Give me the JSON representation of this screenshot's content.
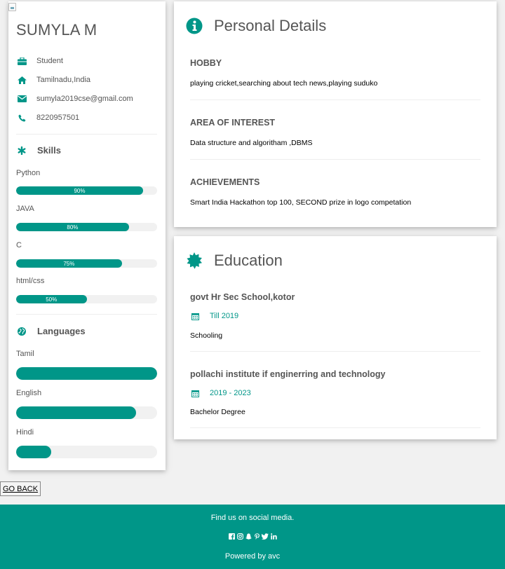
{
  "profile": {
    "name": "SUMYLA M",
    "info": [
      {
        "icon": "briefcase-icon",
        "text": "Student"
      },
      {
        "icon": "home-icon",
        "text": "Tamilnadu,India"
      },
      {
        "icon": "envelope-icon",
        "text": "sumyla2019cse@gmail.com"
      },
      {
        "icon": "phone-icon",
        "text": "8220957501"
      }
    ]
  },
  "skills": {
    "title": "Skills",
    "items": [
      {
        "label": "Python",
        "percent_text": "90%",
        "level": 0.9
      },
      {
        "label": "JAVA",
        "percent_text": "80%",
        "level": 0.8
      },
      {
        "label": "C",
        "percent_text": "75%",
        "level": 0.75
      },
      {
        "label": "html/css",
        "percent_text": "50%",
        "level": 0.5
      }
    ]
  },
  "languages": {
    "title": "Languages",
    "items": [
      {
        "label": "Tamil",
        "level": 1.0
      },
      {
        "label": "English",
        "level": 0.85
      },
      {
        "label": "Hindi",
        "level": 0.25
      }
    ]
  },
  "personal": {
    "title": "Personal Details",
    "sections": [
      {
        "heading": "HOBBY",
        "text": "playing cricket,searching about tech news,playing suduko"
      },
      {
        "heading": "AREA OF INTEREST",
        "text": "Data structure and algoritham ,DBMS"
      },
      {
        "heading": "ACHIEVEMENTS",
        "text": "Smart India Hackathon top 100, SECOND prize in logo competation"
      }
    ]
  },
  "education": {
    "title": "Education",
    "items": [
      {
        "school": "govt Hr Sec School,kotor",
        "date": "Till 2019",
        "degree": "Schooling"
      },
      {
        "school": "pollachi institute if enginerring and technology",
        "date": "2019 - 2023",
        "degree": "Bachelor Degree"
      }
    ]
  },
  "go_back_label": "GO BACK",
  "footer": {
    "find_us": "Find us on social media.",
    "social_icons": [
      "facebook-icon",
      "instagram-icon",
      "snapchat-icon",
      "pinterest-icon",
      "twitter-icon",
      "linkedin-icon"
    ],
    "powered_by": "Powered by avc"
  },
  "colors": {
    "accent": "#009688",
    "text_muted": "#555555",
    "bar_bg": "#f1f1f1",
    "page_bg": "#f1f1f1"
  }
}
